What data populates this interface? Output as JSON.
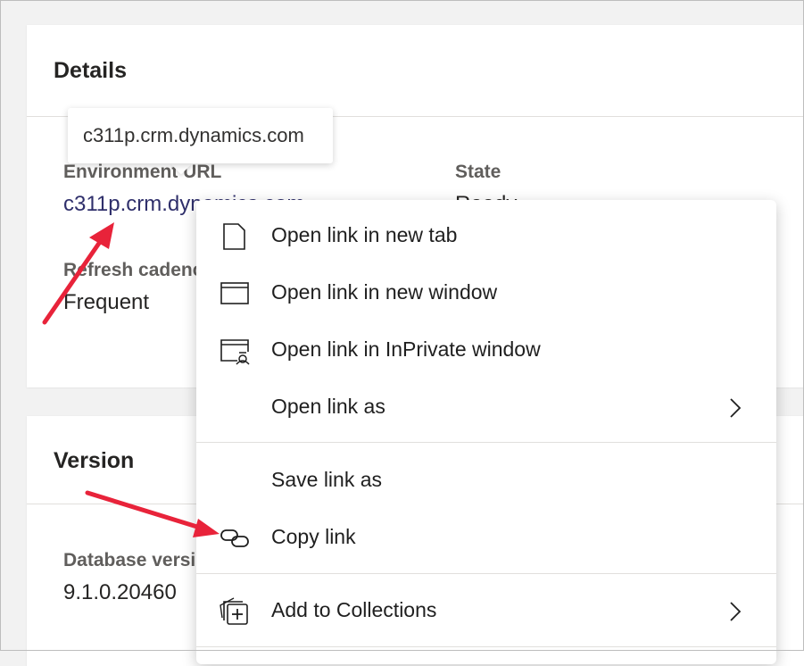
{
  "details": {
    "title": "Details",
    "environment_url_label": "Environment URL",
    "environment_url_value": "c311p.crm.dynamics.com",
    "state_label": "State",
    "state_value": "Ready",
    "refresh_cadence_label": "Refresh cadence",
    "refresh_cadence_value": "Frequent"
  },
  "version": {
    "title": "Version",
    "database_version_label": "Database version",
    "database_version_value": "9.1.0.20460"
  },
  "tooltip": {
    "text": "c311p.crm.dynamics.com"
  },
  "context_menu": {
    "items": [
      {
        "label": "Open link in new tab",
        "icon": "new-tab-icon"
      },
      {
        "label": "Open link in new window",
        "icon": "new-window-icon"
      },
      {
        "label": "Open link in InPrivate window",
        "icon": "inprivate-window-icon"
      },
      {
        "label": "Open link as",
        "icon": "",
        "submenu": true
      },
      {
        "label": "Save link as",
        "icon": ""
      },
      {
        "label": "Copy link",
        "icon": "copy-link-icon"
      },
      {
        "label": "Add to Collections",
        "icon": "add-to-collections-icon",
        "submenu": true
      }
    ]
  },
  "colors": {
    "annotation_arrow": "#e8233a",
    "link_text": "#2f2f6b"
  }
}
